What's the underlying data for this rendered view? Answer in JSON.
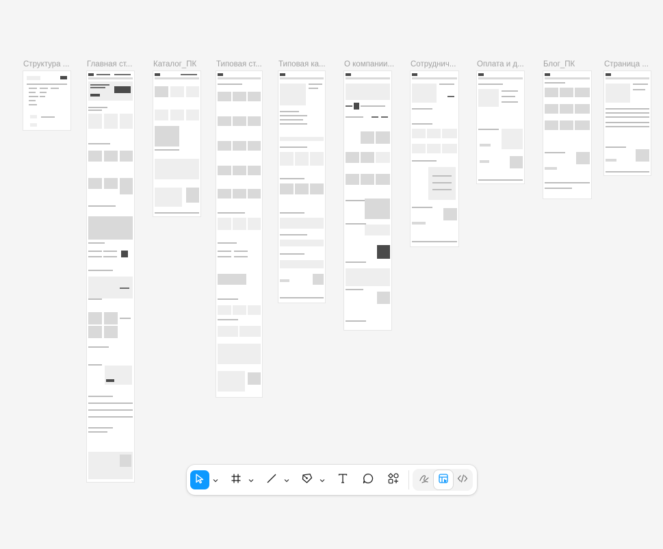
{
  "canvas": {
    "frames": [
      {
        "title": "Структура ..."
      },
      {
        "title": "Главная ст..."
      },
      {
        "title": "Каталог_ПК"
      },
      {
        "title": "Типовая ст..."
      },
      {
        "title": "Типовая ка..."
      },
      {
        "title": "О компании..."
      },
      {
        "title": "Сотруднич..."
      },
      {
        "title": "Оплата и д..."
      },
      {
        "title": "Блог_ПК"
      },
      {
        "title": "Страница ..."
      }
    ]
  },
  "toolbar": {
    "tools": [
      {
        "name": "move",
        "icon": "cursor-arrow-icon",
        "active": true,
        "has_menu": true
      },
      {
        "name": "frame",
        "icon": "frame-hash-icon",
        "active": false,
        "has_menu": true
      },
      {
        "name": "line",
        "icon": "line-icon",
        "active": false,
        "has_menu": true
      },
      {
        "name": "pen",
        "icon": "pen-icon",
        "active": false,
        "has_menu": true
      },
      {
        "name": "text",
        "icon": "text-icon",
        "active": false,
        "has_menu": false
      },
      {
        "name": "comment",
        "icon": "comment-bubble-icon",
        "active": false,
        "has_menu": false
      },
      {
        "name": "actions",
        "icon": "shapes-plus-icon",
        "active": false,
        "has_menu": false
      }
    ],
    "modes": [
      {
        "name": "draw",
        "icon": "draw-squiggle-icon",
        "selected": false
      },
      {
        "name": "design",
        "icon": "design-mode-icon",
        "selected": true
      },
      {
        "name": "dev",
        "icon": "code-brackets-icon",
        "selected": false
      }
    ],
    "accent_color": "#0d99ff"
  }
}
